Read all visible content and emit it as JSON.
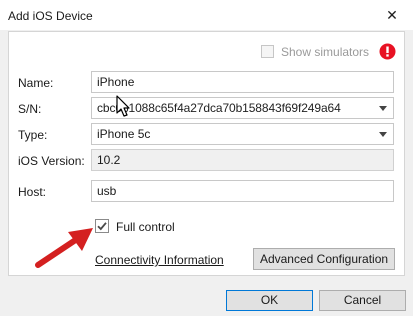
{
  "window": {
    "title": "Add iOS Device",
    "close_glyph": "✕"
  },
  "simulators": {
    "label": "Show simulators",
    "checked": false,
    "warning_icon": "error-exclamation-icon",
    "warning_color": "#e81123"
  },
  "form": {
    "name": {
      "label": "Name:",
      "value": "iPhone"
    },
    "sn": {
      "label": "S/N:",
      "value": "cbc​0b1088c65f4a27dca70b158843f69f249a64"
    },
    "type": {
      "label": "Type:",
      "value": "iPhone 5c"
    },
    "ios_version": {
      "label": "iOS Version:",
      "value": "10.2"
    },
    "host": {
      "label": "Host:",
      "value": "usb"
    }
  },
  "full_control": {
    "label": "Full control",
    "checked": true
  },
  "links": {
    "connectivity": "Connectivity Information"
  },
  "buttons": {
    "advanced": "Advanced Configuration",
    "ok": "OK",
    "cancel": "Cancel"
  },
  "annotation": {
    "arrow_color": "#d42020"
  }
}
